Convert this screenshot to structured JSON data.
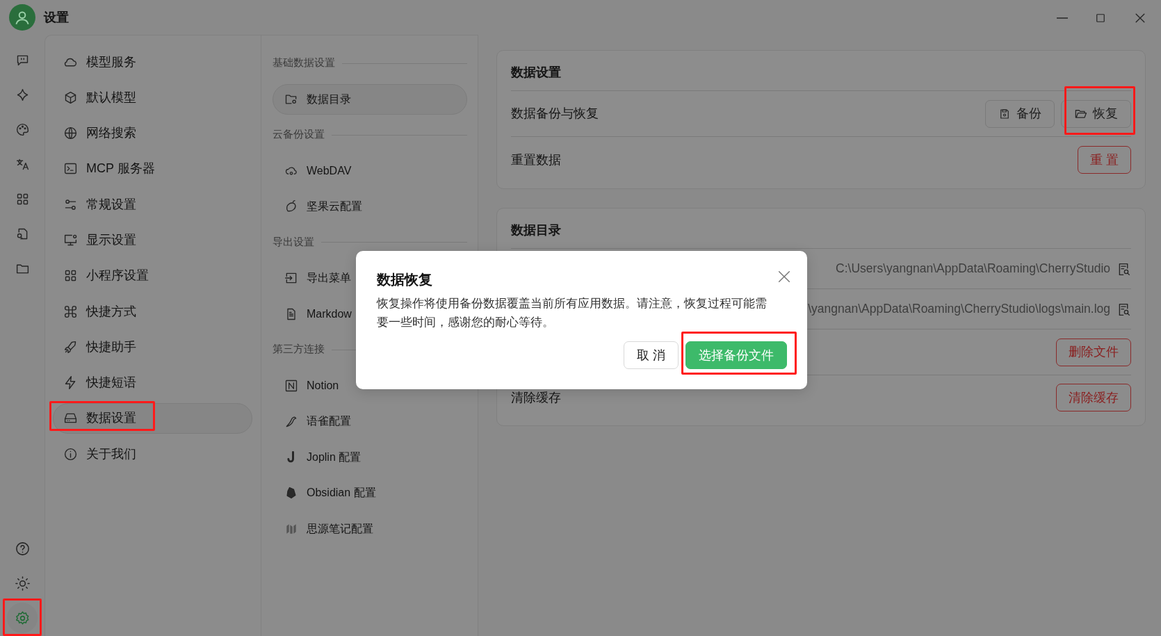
{
  "window": {
    "title": "设置"
  },
  "nav_rail": {
    "bottom": [
      {
        "selected": false,
        "highlighted": false
      },
      {
        "selected": false,
        "highlighted": false
      },
      {
        "selected": true,
        "highlighted": true
      }
    ]
  },
  "sidebar": {
    "items": [
      {
        "label": "模型服务",
        "selected": false,
        "highlighted": false
      },
      {
        "label": "默认模型",
        "selected": false,
        "highlighted": false
      },
      {
        "label": "网络搜索",
        "selected": false,
        "highlighted": false
      },
      {
        "label": "MCP 服务器",
        "selected": false,
        "highlighted": false
      },
      {
        "label": "常规设置",
        "selected": false,
        "highlighted": false
      },
      {
        "label": "显示设置",
        "selected": false,
        "highlighted": false
      },
      {
        "label": "小程序设置",
        "selected": false,
        "highlighted": false
      },
      {
        "label": "快捷方式",
        "selected": false,
        "highlighted": false
      },
      {
        "label": "快捷助手",
        "selected": false,
        "highlighted": false
      },
      {
        "label": "快捷短语",
        "selected": false,
        "highlighted": false
      },
      {
        "label": "数据设置",
        "selected": true,
        "highlighted": true
      },
      {
        "label": "关于我们",
        "selected": false,
        "highlighted": false
      }
    ]
  },
  "data_menu": {
    "sections": [
      {
        "heading": "基础数据设置",
        "items": [
          {
            "label": "数据目录",
            "selected": true
          }
        ]
      },
      {
        "heading": "云备份设置",
        "items": [
          {
            "label": "WebDAV",
            "selected": false
          },
          {
            "label": "坚果云配置",
            "selected": false
          }
        ]
      },
      {
        "heading": "导出设置",
        "items": [
          {
            "label": "导出菜单",
            "selected": false
          },
          {
            "label": "Markdow",
            "selected": false
          }
        ]
      },
      {
        "heading": "第三方连接",
        "items": [
          {
            "label": "Notion",
            "selected": false
          },
          {
            "label": "语雀配置",
            "selected": false
          },
          {
            "label": "Joplin 配置",
            "selected": false
          },
          {
            "label": "Obsidian 配置",
            "selected": false
          },
          {
            "label": "思源笔记配置",
            "selected": false
          }
        ]
      }
    ]
  },
  "cards": [
    {
      "title": "数据设置",
      "rows": [
        {
          "label": "数据备份与恢复",
          "buttons": [
            {
              "label": "备份",
              "kind": "default",
              "highlighted": false
            },
            {
              "label": "恢复",
              "kind": "default",
              "highlighted": true
            }
          ]
        },
        {
          "label": "重置数据",
          "buttons": [
            {
              "label": "重 置",
              "kind": "danger",
              "highlighted": false
            }
          ]
        }
      ]
    },
    {
      "title": "数据目录",
      "rows": [
        {
          "path": "C:\\Users\\yangnan\\AppData\\Roaming\\CherryStudio"
        },
        {
          "path": "\\yangnan\\AppData\\Roaming\\CherryStudio\\logs\\main.log"
        },
        {
          "buttons": [
            {
              "label": "删除文件",
              "kind": "danger",
              "highlighted": false
            }
          ]
        },
        {
          "label": "清除缓存",
          "buttons": [
            {
              "label": "清除缓存",
              "kind": "danger",
              "highlighted": false
            }
          ]
        }
      ]
    }
  ],
  "dialog": {
    "title": "数据恢复",
    "body": "恢复操作将使用备份数据覆盖当前所有应用数据。请注意，恢复过程可能需要一些时间，感谢您的耐心等待。",
    "buttons": [
      {
        "label": "取 消",
        "kind": "default",
        "highlighted": false
      },
      {
        "label": "选择备份文件",
        "kind": "primary",
        "highlighted": true
      }
    ]
  }
}
